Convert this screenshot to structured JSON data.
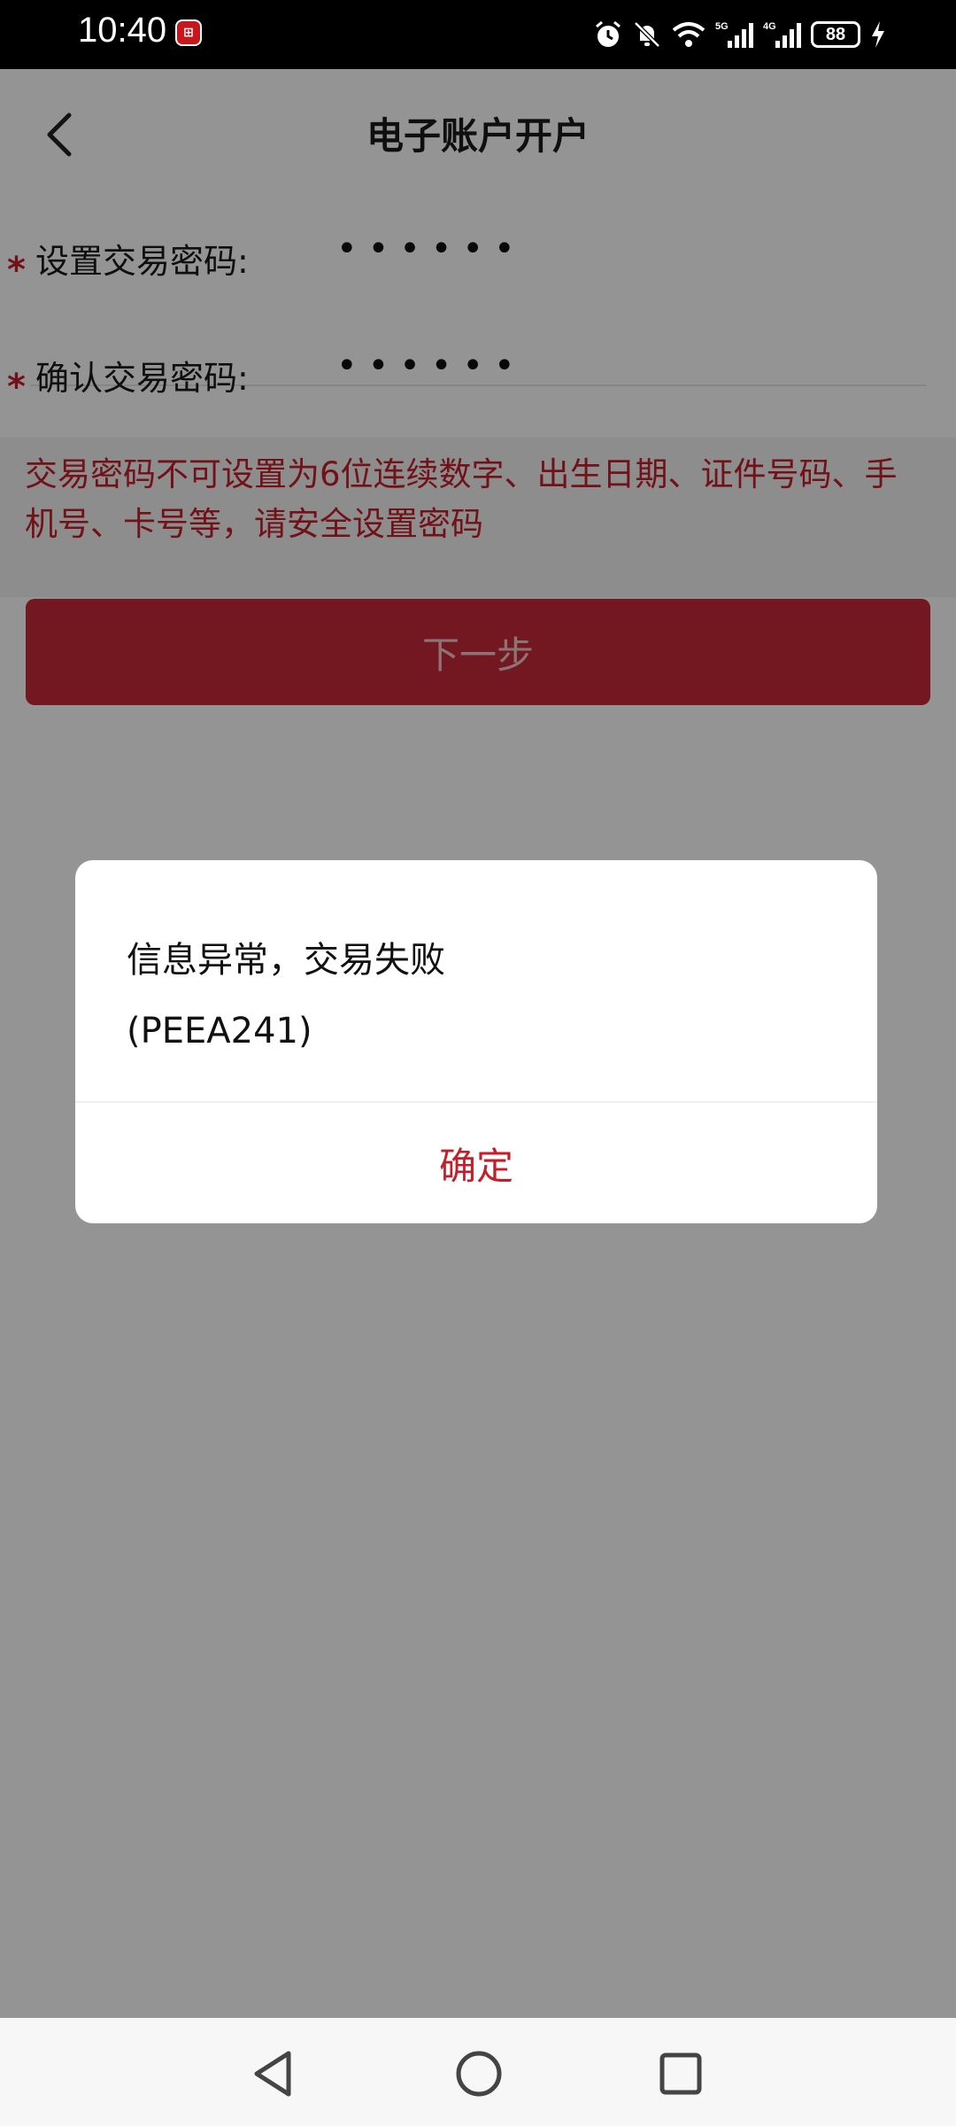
{
  "status_bar": {
    "time": "10:40",
    "app_badge": "⊞",
    "battery": "88",
    "network_5g": "5G",
    "network_4g": "4G"
  },
  "nav": {
    "title": "电子账户开户"
  },
  "form": {
    "set_label": "设置交易密码:",
    "set_value": "••••••",
    "confirm_label": "确认交易密码:",
    "confirm_value": "••••••",
    "required_mark": "*"
  },
  "hint": "交易密码不可设置为6位连续数字、出生日期、证件号码、手机号、卡号等，请安全设置密码",
  "next_button": "下一步",
  "dialog": {
    "message_line1": "信息异常，交易失败",
    "message_line2": "(PEEA241)",
    "ok_button": "确定"
  },
  "colors": {
    "accent": "#c41e2a",
    "button": "#c72a37"
  }
}
